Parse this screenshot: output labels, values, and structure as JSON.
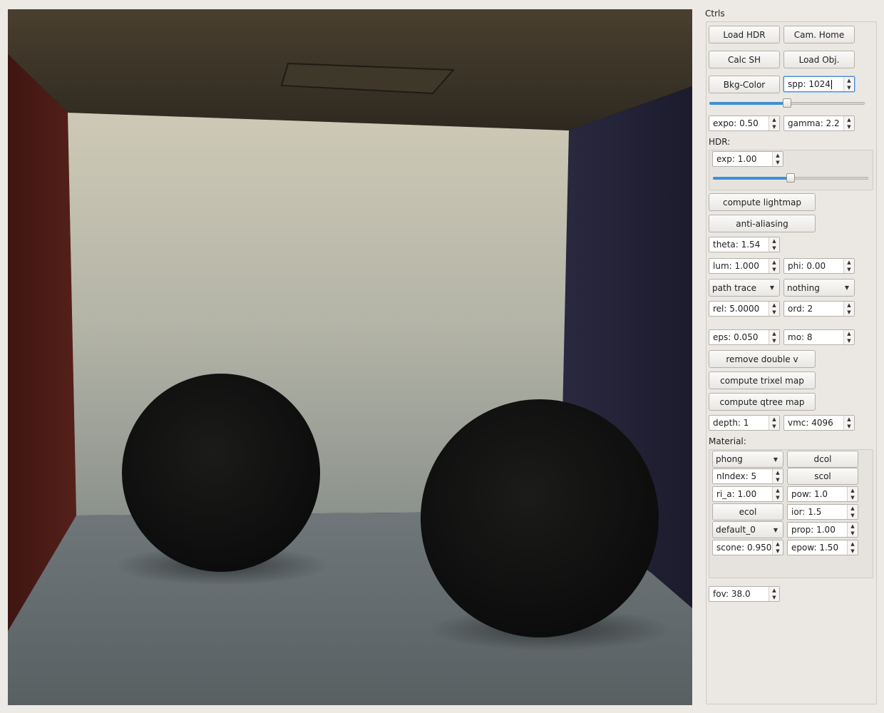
{
  "panel": {
    "title": "Ctrls",
    "buttons": {
      "load_hdr": "Load HDR",
      "cam_home": "Cam. Home",
      "calc_sh": "Calc SH",
      "load_obj": "Load Obj.",
      "bkg_color": "Bkg-Color",
      "compute_lightmap": "compute lightmap",
      "anti_aliasing": "anti-aliasing",
      "remove_double_v": "remove double v",
      "compute_trixel_map": "compute trixel map",
      "compute_qtree_map": "compute qtree map"
    },
    "spp": "spp: 1024",
    "spp_slider_fraction": 0.5,
    "expo": "expo: 0.50",
    "gamma": "gamma: 2.2",
    "hdr_label": "HDR:",
    "hdr_exp": "exp: 1.00",
    "hdr_slider_fraction": 0.5,
    "theta": "theta: 1.54",
    "lum": "lum: 1.000",
    "phi": "phi: 0.00",
    "render_mode": "path trace",
    "mode2": "nothing",
    "rel": "rel: 5.0000",
    "ord": "ord: 2",
    "eps": "eps: 0.050",
    "mo": "mo: 8",
    "depth": "depth: 1",
    "vmc": "vmc: 4096",
    "material_label": "Material:",
    "material": {
      "shader": "phong",
      "dcol": "dcol",
      "nindex": "nIndex: 5",
      "scol": "scol",
      "ri_a": "ri_a: 1.00",
      "pow": "pow: 1.0",
      "ecol": "ecol",
      "ior": "ior: 1.5",
      "material_name": "default_0",
      "prop": "prop: 1.00",
      "scone": "scone: 0.950",
      "epow": "epow: 1.50"
    },
    "fov": "fov: 38.0"
  },
  "icons": {
    "spin_up": "▲",
    "spin_down": "▼",
    "dropdown": "▼"
  },
  "colors": {
    "accent": "#3d8fd8",
    "wall_left": "#4a1a16",
    "wall_right": "#232038",
    "sphere": "#141414"
  }
}
